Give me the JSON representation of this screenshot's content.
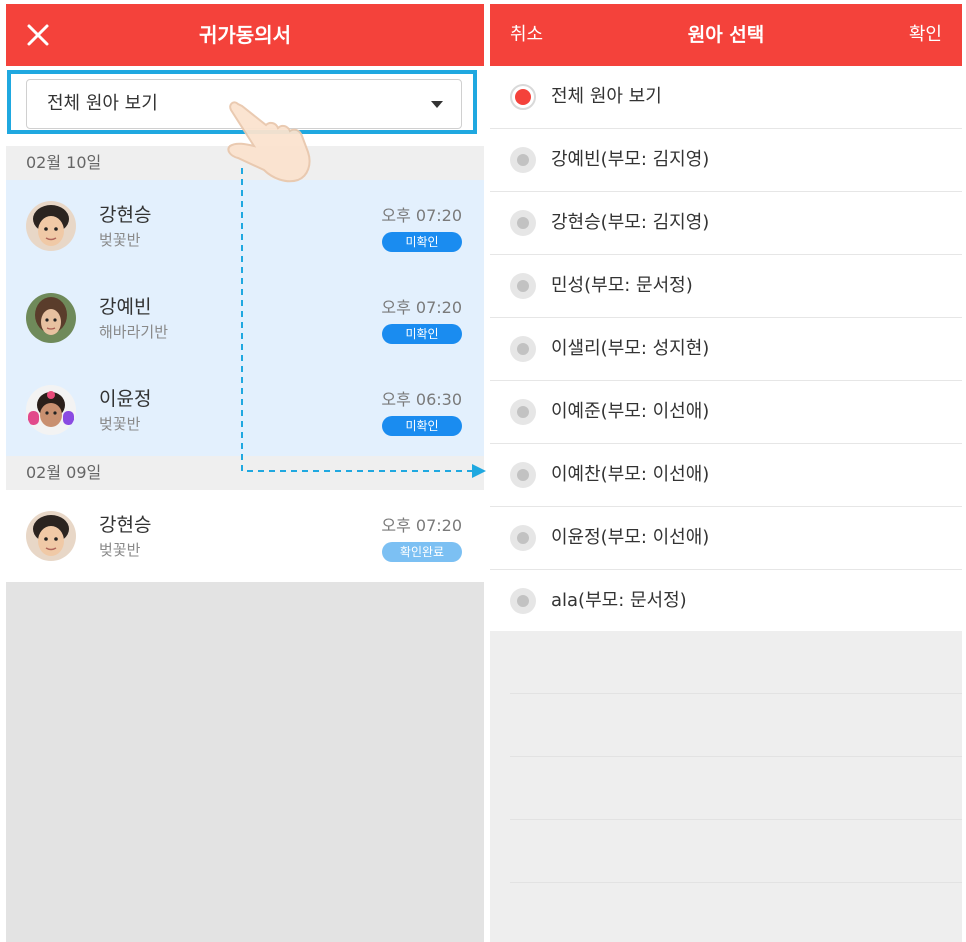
{
  "colors": {
    "brand_red": "#f4423b",
    "highlight_blue": "#1fa8e0",
    "unread_row_bg": "#e3f0fd",
    "badge_pending": "#1a8cf0",
    "badge_done": "#7cc0f3"
  },
  "left_screen": {
    "header": {
      "title": "귀가동의서",
      "close_icon": "close-icon"
    },
    "filter": {
      "selected": "전체 원아 보기",
      "caret_icon": "caret-down-icon"
    },
    "sections": [
      {
        "date": "02월 10일",
        "records": [
          {
            "name": "강현승",
            "class": "벚꽃반",
            "time": "오후 07:20",
            "status": "미확인"
          },
          {
            "name": "강예빈",
            "class": "해바라기반",
            "time": "오후 07:20",
            "status": "미확인"
          },
          {
            "name": "이윤정",
            "class": "벚꽃반",
            "time": "오후 06:30",
            "status": "미확인"
          }
        ]
      },
      {
        "date": "02월 09일",
        "records": [
          {
            "name": "강현승",
            "class": "벚꽃반",
            "time": "오후 07:20",
            "status": "확인완료"
          }
        ]
      }
    ]
  },
  "right_screen": {
    "header": {
      "cancel": "취소",
      "title": "원아 선택",
      "confirm": "확인"
    },
    "options": [
      {
        "label": "전체 원아 보기",
        "selected": true
      },
      {
        "label": "강예빈(부모: 김지영)",
        "selected": false
      },
      {
        "label": "강현승(부모: 김지영)",
        "selected": false
      },
      {
        "label": "민성(부모: 문서정)",
        "selected": false
      },
      {
        "label": "이샐리(부모: 성지현)",
        "selected": false
      },
      {
        "label": "이예준(부모: 이선애)",
        "selected": false
      },
      {
        "label": "이예찬(부모: 이선애)",
        "selected": false
      },
      {
        "label": "이윤정(부모: 이선애)",
        "selected": false
      },
      {
        "label": "ala(부모: 문서정)",
        "selected": false
      }
    ]
  }
}
